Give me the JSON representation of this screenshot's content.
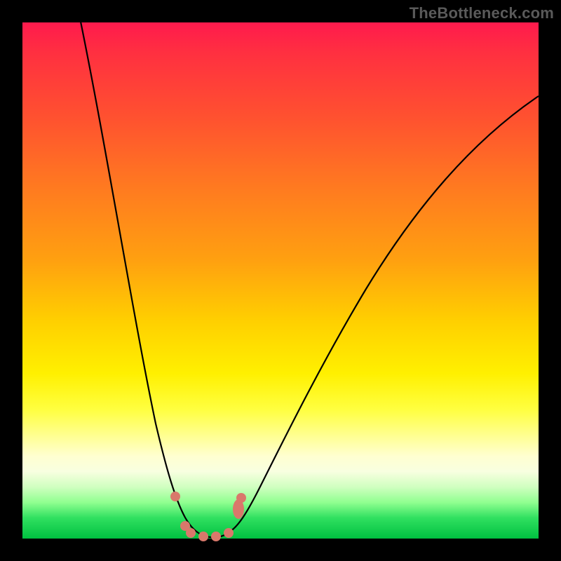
{
  "watermark": "TheBottleneck.com",
  "colors": {
    "gradient_top": "#ff1a4d",
    "gradient_mid": "#fff000",
    "gradient_bottom": "#00c040",
    "curve": "#000000",
    "dots": "#d9786b",
    "frame": "#000000",
    "watermark_text": "#5a5a5a"
  },
  "chart_data": {
    "type": "line",
    "title": "",
    "xlabel": "",
    "ylabel": "",
    "xlim": [
      0,
      100
    ],
    "ylim": [
      0,
      100
    ],
    "grid": false,
    "legend": false,
    "background": "heatmap-gradient red→yellow→green top→bottom",
    "series": [
      {
        "name": "bottleneck-curve",
        "description": "V-shaped curve: steep on the left, shallower on the right; minimum near x≈36",
        "x": [
          11,
          16,
          21,
          26,
          30,
          33,
          36,
          40,
          46,
          55,
          66,
          80,
          100
        ],
        "values": [
          100,
          75,
          48,
          28,
          14,
          6,
          0.5,
          3,
          12,
          27,
          45,
          65,
          86
        ]
      }
    ],
    "points": [
      {
        "name": "left-shoulder",
        "x": 30,
        "y": 8
      },
      {
        "name": "left-slope-1",
        "x": 32,
        "y": 2.5
      },
      {
        "name": "left-slope-2",
        "x": 33,
        "y": 1
      },
      {
        "name": "trough-1",
        "x": 35,
        "y": 0.4
      },
      {
        "name": "trough-2",
        "x": 37,
        "y": 0.4
      },
      {
        "name": "right-slope-1",
        "x": 40,
        "y": 1
      },
      {
        "name": "right-cluster",
        "x": 42,
        "y": 5.5
      },
      {
        "name": "right-shoulder",
        "x": 42.5,
        "y": 8
      }
    ],
    "annotations": []
  }
}
